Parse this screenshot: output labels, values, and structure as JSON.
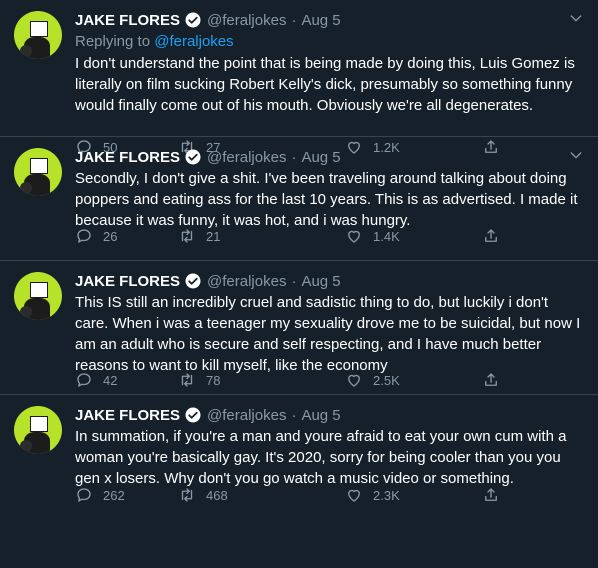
{
  "colors": {
    "background": "#15202b",
    "text": "#ffffff",
    "muted": "#8899a6",
    "link": "#1da1f2",
    "divider": "#38444d",
    "avatar": "#b6e22a"
  },
  "tweets": [
    {
      "name": "JAKE FLORES",
      "handle": "@feraljokes",
      "sep": "·",
      "date": "Aug 5",
      "replying_prefix": "Replying to",
      "replying_to": "@feraljokes",
      "text": "I don't understand the point that is being made by doing this, Luis Gomez is literally on film sucking Robert Kelly's dick, presumably so something funny would finally come out of his mouth. Obviously we're all degenerates.",
      "replies": "50",
      "retweets": "27",
      "likes": "1.2K"
    },
    {
      "name": "JAKE FLORES",
      "handle": "@feraljokes",
      "sep": "·",
      "date": "Aug 5",
      "text": "Secondly, I don't give a shit. I've been traveling around talking about doing poppers and eating ass for the last 10 years. This is as advertised. I made it because it was funny, it was hot, and i was hungry.",
      "replies": "26",
      "retweets": "21",
      "likes": "1.4K"
    },
    {
      "name": "JAKE FLORES",
      "handle": "@feraljokes",
      "sep": "·",
      "date": "Aug 5",
      "text": "This IS still an incredibly cruel and sadistic thing to do, but luckily i don't care. When i was a teenager my sexuality drove me to be suicidal, but now I am an adult who is secure and self respecting, and I have much better reasons to want to kill myself, like the economy",
      "replies": "42",
      "retweets": "78",
      "likes": "2.5K"
    },
    {
      "name": "JAKE FLORES",
      "handle": "@feraljokes",
      "sep": "·",
      "date": "Aug 5",
      "text": "In summation, if you're a man and youre afraid to eat your own cum with a woman you're basically gay. It's 2020, sorry for being cooler than you you gen x losers. Why don't you go watch a music video or something.",
      "replies": "262",
      "retweets": "468",
      "likes": "2.3K"
    }
  ]
}
